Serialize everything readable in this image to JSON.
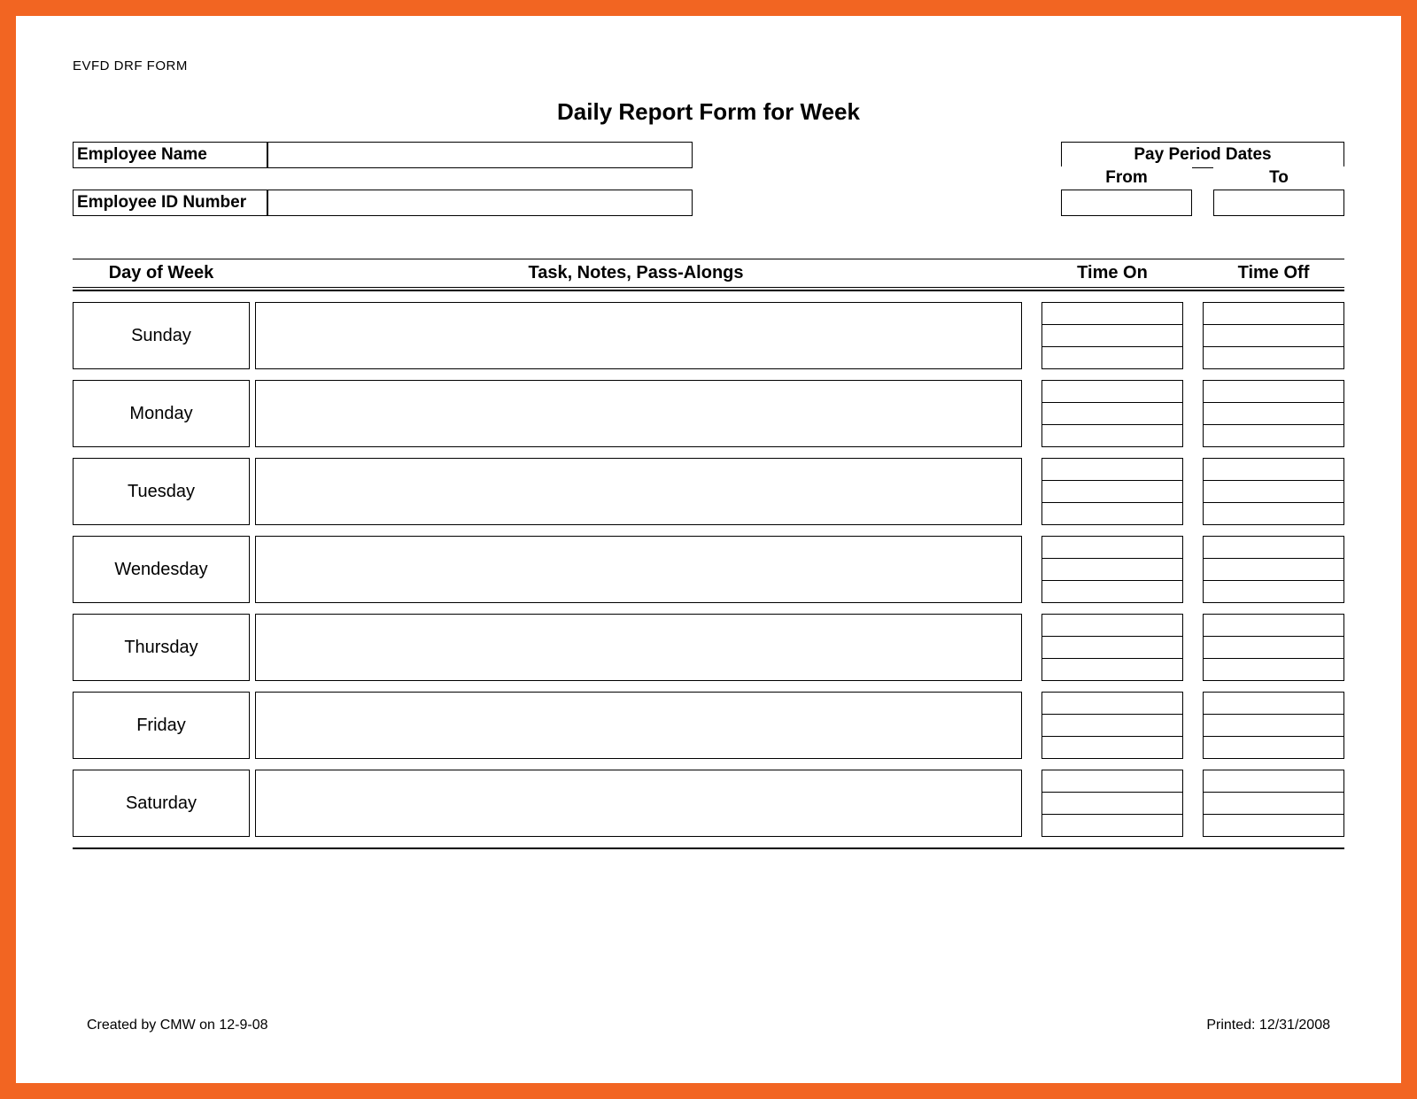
{
  "corner_label": "EVFD DRF FORM",
  "title": "Daily Report Form for Week",
  "header": {
    "employee_name_label": "Employee Name",
    "employee_name_value": "",
    "employee_id_label": "Employee ID Number",
    "employee_id_value": "",
    "pay_period_label": "Pay Period Dates",
    "from_label": "From",
    "to_label": "To",
    "from_value": "",
    "to_value": ""
  },
  "columns": {
    "day": "Day of Week",
    "task": "Task, Notes, Pass-Alongs",
    "time_on": "Time On",
    "time_off": "Time Off"
  },
  "days": [
    {
      "name": "Sunday",
      "task": "",
      "time_on": [
        "",
        "",
        ""
      ],
      "time_off": [
        "",
        "",
        ""
      ]
    },
    {
      "name": "Monday",
      "task": "",
      "time_on": [
        "",
        "",
        ""
      ],
      "time_off": [
        "",
        "",
        ""
      ]
    },
    {
      "name": "Tuesday",
      "task": "",
      "time_on": [
        "",
        "",
        ""
      ],
      "time_off": [
        "",
        "",
        ""
      ]
    },
    {
      "name": "Wendesday",
      "task": "",
      "time_on": [
        "",
        "",
        ""
      ],
      "time_off": [
        "",
        "",
        ""
      ]
    },
    {
      "name": "Thursday",
      "task": "",
      "time_on": [
        "",
        "",
        ""
      ],
      "time_off": [
        "",
        "",
        ""
      ]
    },
    {
      "name": "Friday",
      "task": "",
      "time_on": [
        "",
        "",
        ""
      ],
      "time_off": [
        "",
        "",
        ""
      ]
    },
    {
      "name": "Saturday",
      "task": "",
      "time_on": [
        "",
        "",
        ""
      ],
      "time_off": [
        "",
        "",
        ""
      ]
    }
  ],
  "footer": {
    "created": "Created by CMW on 12-9-08",
    "printed": "Printed: 12/31/2008"
  }
}
